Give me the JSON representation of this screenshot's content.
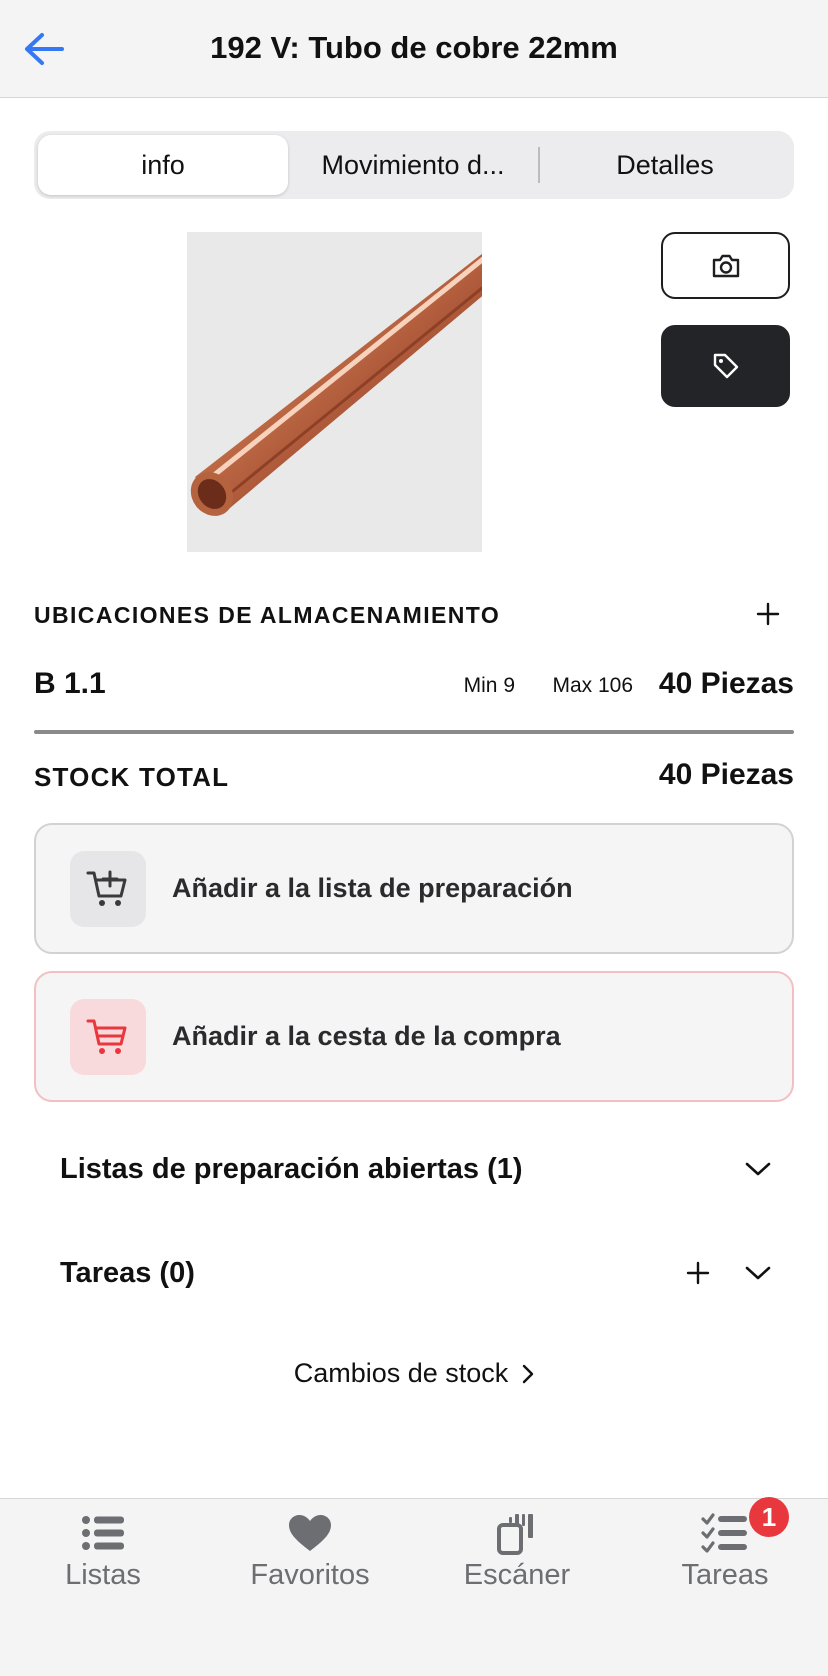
{
  "header": {
    "title": "192 V: Tubo de cobre 22mm",
    "back_icon": "arrow-left-icon"
  },
  "tabs": [
    {
      "label": "info",
      "active": true
    },
    {
      "label": "Movimiento d...",
      "active": false
    },
    {
      "label": "Detalles",
      "active": false
    }
  ],
  "image": {
    "alt": "Tubo de cobre 22mm"
  },
  "image_actions": {
    "camera_icon": "camera-icon",
    "tag_icon": "tag-icon"
  },
  "storage": {
    "section_title": "UBICACIONES DE ALMACENAMIENTO",
    "locations": [
      {
        "name": "B 1.1",
        "min": "Min 9",
        "max": "Max 106",
        "quantity": "40 Piezas"
      }
    ]
  },
  "stock_total": {
    "label": "STOCK TOTAL",
    "quantity": "40 Piezas"
  },
  "actions": {
    "prep_list_label": "Añadir a la lista de preparación",
    "cart_label": "Añadir a la cesta de la compra"
  },
  "sections": {
    "open_prep_lists": "Listas de preparación abiertas (1)",
    "tasks": "Tareas (0)"
  },
  "stock_changes_link": "Cambios de stock",
  "tabbar": [
    {
      "label": "Listas",
      "icon": "list-icon"
    },
    {
      "label": "Favoritos",
      "icon": "heart-icon"
    },
    {
      "label": "Escáner",
      "icon": "scanner-icon"
    },
    {
      "label": "Tareas",
      "icon": "tasks-checklist-icon",
      "badge": "1"
    }
  ],
  "colors": {
    "accent": "#3478f6",
    "danger": "#e8373d",
    "dark_button": "#232427",
    "tab_label": "#6d6e72"
  }
}
